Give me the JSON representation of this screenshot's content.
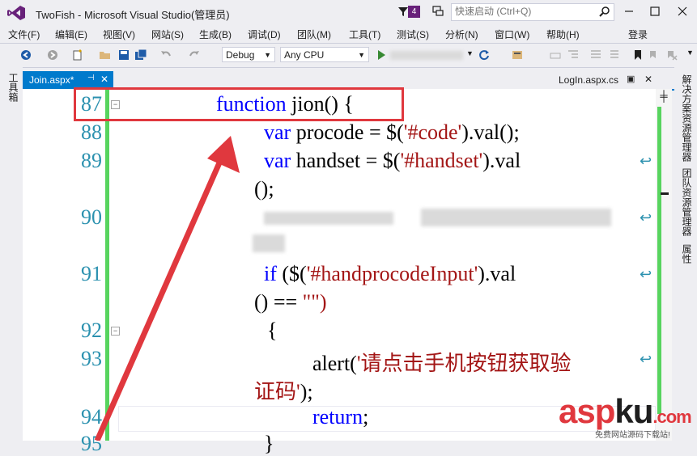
{
  "window": {
    "title": "TwoFish - Microsoft Visual Studio(管理员)",
    "notification_count": "4",
    "quick_launch_placeholder": "快速启动 (Ctrl+Q)"
  },
  "menu": {
    "items": [
      "文件(F)",
      "编辑(E)",
      "视图(V)",
      "网站(S)",
      "生成(B)",
      "调试(D)",
      "团队(M)",
      "工具(T)",
      "测试(S)",
      "分析(N)",
      "窗口(W)",
      "帮助(H)"
    ],
    "login": "登录"
  },
  "toolbar": {
    "configuration": "Debug",
    "platform": "Any CPU"
  },
  "left_dock": {
    "toolbox": "工具箱"
  },
  "right_dock": {
    "solution_explorer": "解决方案资源管理器",
    "team_explorer": "团队资源管理器",
    "properties": "属性"
  },
  "tabs": {
    "active": "Join.aspx*",
    "other": "LogIn.aspx.cs"
  },
  "code": {
    "line_numbers": [
      "87",
      "88",
      "89",
      "90",
      "91",
      "92",
      "93",
      "94",
      "95"
    ],
    "line87_kw": "function",
    "line87_rest": " jion() {",
    "line88_kw": "var",
    "line88_a": " procode = $(",
    "line88_str": "'#code'",
    "line88_b": ").val();",
    "line89_kw": "var",
    "line89_a": " handset = $(",
    "line89_str": "'#handset'",
    "line89_b": ").val",
    "line89_cont": "();",
    "line91_kw": "if",
    "line91_a": " ($(",
    "line91_str": "'#handprocodeInput'",
    "line91_b": ").val",
    "line91_cont_a": "() == ",
    "line91_cont_str": "\"\")",
    "line92": "{",
    "line93_a": "alert(",
    "line93_str": "'请点击手机按钮获取验",
    "line93_cont_str": "证码'",
    "line93_cont_b": ");",
    "line94_kw": "return",
    "line94_b": ";",
    "line95": "}"
  },
  "watermark": {
    "main_a": "asp",
    "main_b": "ku",
    "domain": ".com",
    "sub": "免费网站源码下载站!"
  },
  "colors": {
    "accent": "#007ACC",
    "vs_purple": "#68217A",
    "annotation_red": "#E0383E",
    "keyword": "#0000FF",
    "string": "#A31515",
    "line_number": "#2B91AF",
    "change_bar": "#57D45E"
  }
}
